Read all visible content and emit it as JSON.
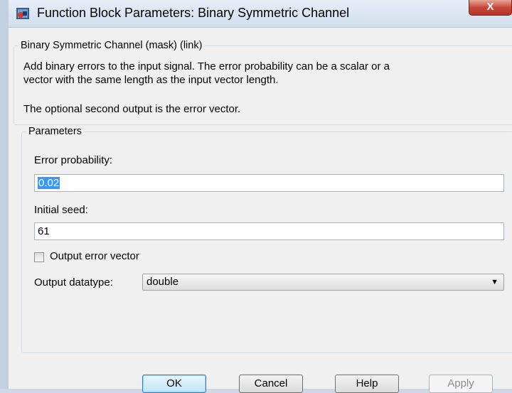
{
  "window": {
    "title": "Function Block Parameters: Binary Symmetric Channel",
    "close_glyph": "X"
  },
  "mask": {
    "group_title": "Binary Symmetric Channel (mask) (link)",
    "description_line1": "Add binary errors to the input signal. The error probability can be a scalar or a",
    "description_line2": "vector with the same length as the input vector length.",
    "description_line3": "The optional second output is the error vector."
  },
  "parameters": {
    "group_title": "Parameters",
    "error_probability_label": "Error probability:",
    "error_probability_value": "0.02",
    "initial_seed_label": "Initial seed:",
    "initial_seed_value": "61",
    "output_error_vector_label": "Output error vector",
    "output_error_vector_checked": false,
    "output_datatype_label": "Output datatype:",
    "output_datatype_value": "double"
  },
  "buttons": {
    "ok": "OK",
    "cancel": "Cancel",
    "help": "Help",
    "apply": "Apply"
  },
  "colors": {
    "selection": "#3399ff",
    "close_button": "#c7483a"
  }
}
